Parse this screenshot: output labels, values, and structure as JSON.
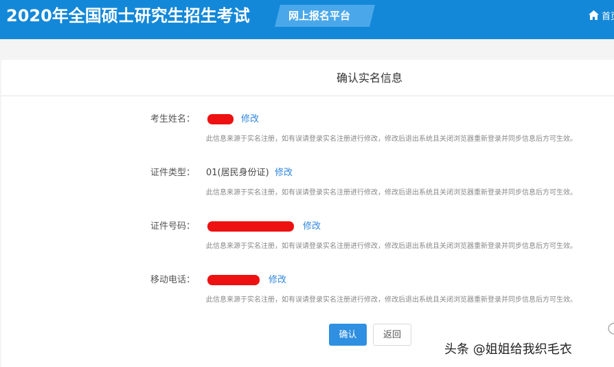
{
  "header": {
    "site_title": "2020年全国硕士研究生招生考试",
    "platform_label": "网上报名平台",
    "home_label": "首页"
  },
  "card": {
    "title": "确认实名信息",
    "rows": [
      {
        "label": "考生姓名：",
        "value": "",
        "edit": "修改",
        "note": "此信息来源于实名注册，如有误请登录实名注册进行修改，修改后退出系统且关闭浏览器重新登录并同步信息后方可生效。"
      },
      {
        "label": "证件类型：",
        "value": "01(居民身份证)",
        "edit": "修改",
        "note": "此信息来源于实名注册，如有误请登录实名注册进行修改，修改后退出系统且关闭浏览器重新登录并同步信息后方可生效。"
      },
      {
        "label": "证件号码：",
        "value": "",
        "edit": "修改",
        "note": "此信息来源于实名注册，如有误请登录实名注册进行修改，修改后退出系统且关闭浏览器重新登录并同步信息后方可生效。"
      },
      {
        "label": "移动电话：",
        "value": "",
        "edit": "修改",
        "note": "此信息来源于实名注册，如有误请登录实名注册进行修改，修改后退出系统且关闭浏览器重新登录并同步信息后方可生效。"
      }
    ]
  },
  "actions": {
    "confirm_label": "确认",
    "back_label": "返回"
  },
  "watermark": "头条 @姐姐给我织毛衣",
  "colors": {
    "header_bg": "#1488d8",
    "badge_bg": "#4aa8ea",
    "link": "#2e86de",
    "primary_button": "#2f8fe0",
    "redaction": "#ee1111"
  },
  "icons": {
    "home": "home-icon"
  }
}
